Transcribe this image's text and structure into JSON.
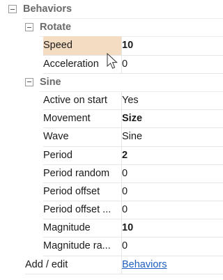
{
  "categories": {
    "behaviors": "Behaviors",
    "rotate": "Rotate",
    "sine": "Sine"
  },
  "rotate_props": [
    {
      "name": "Speed",
      "value": "10"
    },
    {
      "name": "Acceleration",
      "value": "0"
    }
  ],
  "sine_props": [
    {
      "name": "Active on start",
      "value": "Yes"
    },
    {
      "name": "Movement",
      "value": "Size"
    },
    {
      "name": "Wave",
      "value": "Sine"
    },
    {
      "name": "Period",
      "value": "2"
    },
    {
      "name": "Period random",
      "value": "0"
    },
    {
      "name": "Period offset",
      "value": "0"
    },
    {
      "name": "Period offset ...",
      "value": "0"
    },
    {
      "name": "Magnitude",
      "value": "10"
    },
    {
      "name": "Magnitude ra...",
      "value": "0"
    }
  ],
  "footer": {
    "label": "Add / edit",
    "link": "Behaviors"
  }
}
